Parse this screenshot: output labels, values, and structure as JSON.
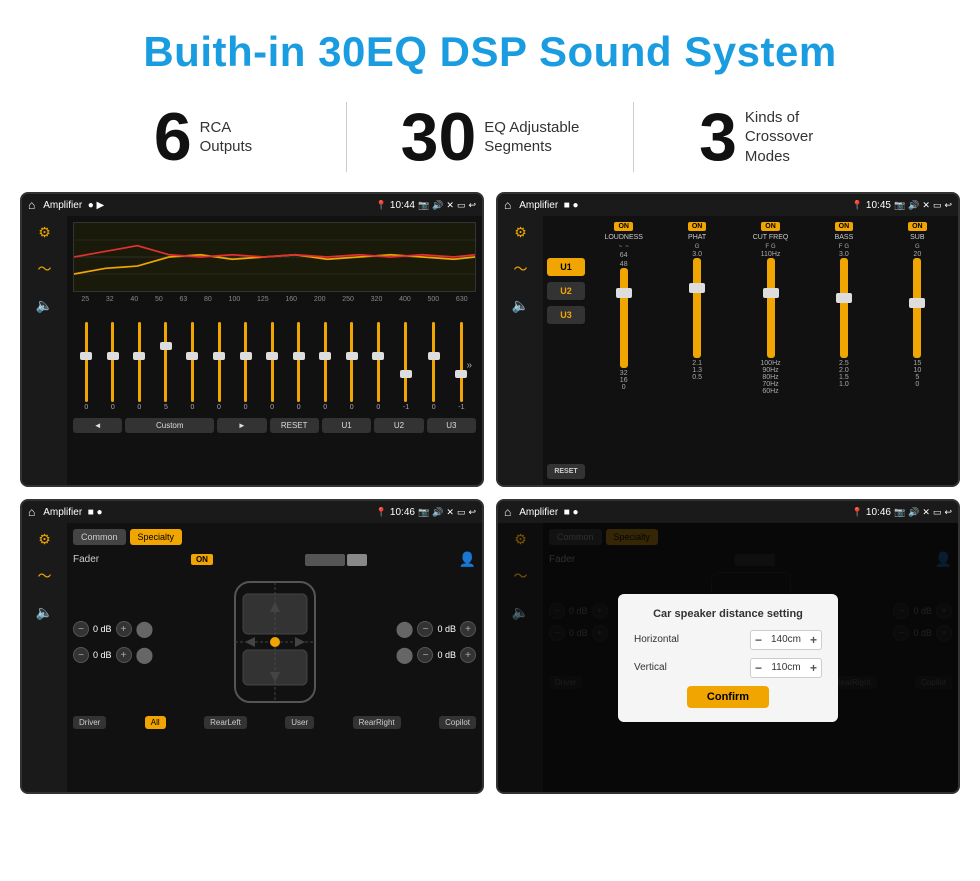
{
  "page": {
    "title": "Buith-in 30EQ DSP Sound System"
  },
  "stats": [
    {
      "number": "6",
      "label": "RCA\nOutputs"
    },
    {
      "number": "30",
      "label": "EQ Adjustable\nSegments"
    },
    {
      "number": "3",
      "label": "Kinds of\nCrossover Modes"
    }
  ],
  "screens": [
    {
      "id": "eq",
      "status": {
        "title": "Amplifier",
        "time": "10:44"
      }
    },
    {
      "id": "crossover",
      "status": {
        "title": "Amplifier",
        "time": "10:45"
      }
    },
    {
      "id": "fader",
      "status": {
        "title": "Amplifier",
        "time": "10:46"
      }
    },
    {
      "id": "distance",
      "status": {
        "title": "Amplifier",
        "time": "10:46"
      }
    }
  ],
  "eq": {
    "freqs": [
      "25",
      "32",
      "40",
      "50",
      "63",
      "80",
      "100",
      "125",
      "160",
      "200",
      "250",
      "320",
      "400",
      "500",
      "630"
    ],
    "values": [
      "0",
      "0",
      "0",
      "5",
      "0",
      "0",
      "0",
      "0",
      "0",
      "0",
      "0",
      "0",
      "-1",
      "0",
      "-1"
    ],
    "controls": [
      "◄",
      "Custom",
      "►",
      "RESET",
      "U1",
      "U2",
      "U3"
    ]
  },
  "crossover": {
    "presets": [
      "U1",
      "U2",
      "U3"
    ],
    "channels": [
      {
        "toggle": "ON",
        "name": "LOUDNESS"
      },
      {
        "toggle": "ON",
        "name": "PHAT"
      },
      {
        "toggle": "ON",
        "name": "CUT FREQ"
      },
      {
        "toggle": "ON",
        "name": "BASS"
      },
      {
        "toggle": "ON",
        "name": "SUB"
      }
    ]
  },
  "fader": {
    "tabs": [
      "Common",
      "Specialty"
    ],
    "label": "Fader",
    "toggleLabel": "ON",
    "speakers": [
      {
        "value": "0 dB"
      },
      {
        "value": "0 dB"
      },
      {
        "value": "0 dB"
      },
      {
        "value": "0 dB"
      }
    ],
    "zones": [
      "Driver",
      "All",
      "RearLeft",
      "User",
      "RearRight",
      "Copilot"
    ]
  },
  "distance": {
    "tabs": [
      "Common",
      "Specialty"
    ],
    "modal": {
      "title": "Car speaker distance setting",
      "horizontal_label": "Horizontal",
      "horizontal_value": "140cm",
      "vertical_label": "Vertical",
      "vertical_value": "110cm",
      "confirm": "Confirm"
    }
  }
}
